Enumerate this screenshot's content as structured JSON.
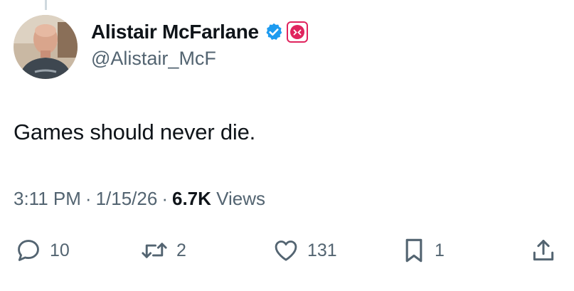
{
  "author": {
    "display_name": "Alistair McFarlane",
    "handle": "@Alistair_McF",
    "verified": true,
    "avatar_icon": "profile-photo",
    "affiliate_badge_icon": "red-affiliate-badge"
  },
  "tweet": {
    "text": "Games should never die.",
    "time": "3:11 PM",
    "separator": "·",
    "date": "1/15/26",
    "views_count": "6.7K",
    "views_label": "Views"
  },
  "actions": {
    "replies": "10",
    "reposts": "2",
    "likes": "131",
    "bookmarks": "1"
  },
  "colors": {
    "text_primary": "#0f1419",
    "text_secondary": "#536471",
    "verified_blue": "#1d9bf0",
    "badge_red": "#e0245e"
  }
}
